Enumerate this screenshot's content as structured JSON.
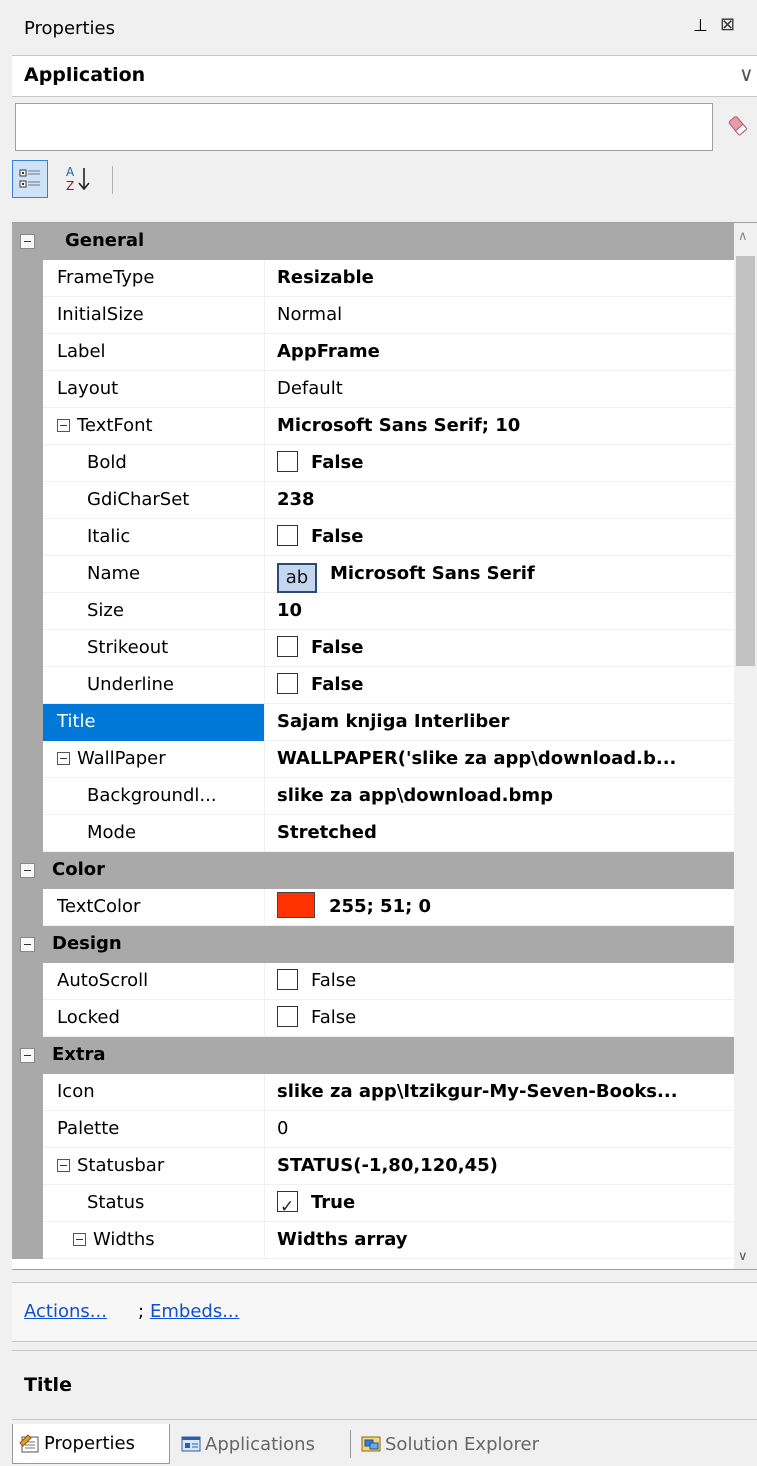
{
  "panel": {
    "title": "Properties",
    "pin_glyph": "⊥",
    "close_glyph": "⊠"
  },
  "object_selector": {
    "value": "Application",
    "chevron": "∨"
  },
  "search": {
    "value": "",
    "clear_icon": "eraser-icon"
  },
  "toolbar": {
    "categorized_icon": "categorized-icon",
    "alphabetical_icon": "sort-az-icon"
  },
  "grid": {
    "categories": {
      "general": "General",
      "color": "Color",
      "design": "Design",
      "extra": "Extra"
    },
    "rows": {
      "frametype": {
        "name": "FrameType",
        "value": "Resizable"
      },
      "initialsize": {
        "name": "InitialSize",
        "value": "Normal"
      },
      "label": {
        "name": "Label",
        "value": "AppFrame"
      },
      "layout": {
        "name": "Layout",
        "value": "Default"
      },
      "textfont": {
        "name": "TextFont",
        "value": "Microsoft Sans Serif; 10"
      },
      "bold": {
        "name": "Bold",
        "value": "False",
        "checked": false
      },
      "gdicharset": {
        "name": "GdiCharSet",
        "value": "238"
      },
      "italic": {
        "name": "Italic",
        "value": "False",
        "checked": false
      },
      "fontname": {
        "name": "Name",
        "value": "Microsoft Sans Serif",
        "badge": "ab"
      },
      "size": {
        "name": "Size",
        "value": "10"
      },
      "strikeout": {
        "name": "Strikeout",
        "value": "False",
        "checked": false
      },
      "underline": {
        "name": "Underline",
        "value": "False",
        "checked": false
      },
      "title": {
        "name": "Title",
        "value": "Sajam knjiga Interliber"
      },
      "wallpaper": {
        "name": "WallPaper",
        "value": "WALLPAPER('slike za app\\download.b..."
      },
      "backgroundimage": {
        "name": "Backgroundl...",
        "value": "slike za app\\download.bmp"
      },
      "mode": {
        "name": "Mode",
        "value": "Stretched"
      },
      "textcolor": {
        "name": "TextColor",
        "value": "255; 51; 0",
        "swatch": "#ff3300"
      },
      "autoscroll": {
        "name": "AutoScroll",
        "value": "False",
        "checked": false
      },
      "locked": {
        "name": "Locked",
        "value": "False",
        "checked": false
      },
      "icon": {
        "name": "Icon",
        "value": "slike za app\\Itzikgur-My-Seven-Books..."
      },
      "palette": {
        "name": "Palette",
        "value": "0"
      },
      "statusbar": {
        "name": "Statusbar",
        "value": "STATUS(-1,80,120,45)"
      },
      "status": {
        "name": "Status",
        "value": "True",
        "checked": true
      },
      "widths": {
        "name": "Widths",
        "value": "Widths array"
      }
    },
    "selected_row": "Title"
  },
  "commands": {
    "actions": "Actions...",
    "separator": ";",
    "embeds": "Embeds..."
  },
  "description": {
    "title": "Title"
  },
  "tabs": [
    {
      "label": "Properties",
      "icon": "properties-icon"
    },
    {
      "label": "Applications",
      "icon": "applications-icon"
    },
    {
      "label": "Solution Explorer",
      "icon": "solution-explorer-icon"
    }
  ],
  "colors": {
    "selection": "#0078d7",
    "category_band": "#a9a9a9",
    "link": "#0f4fd1"
  }
}
